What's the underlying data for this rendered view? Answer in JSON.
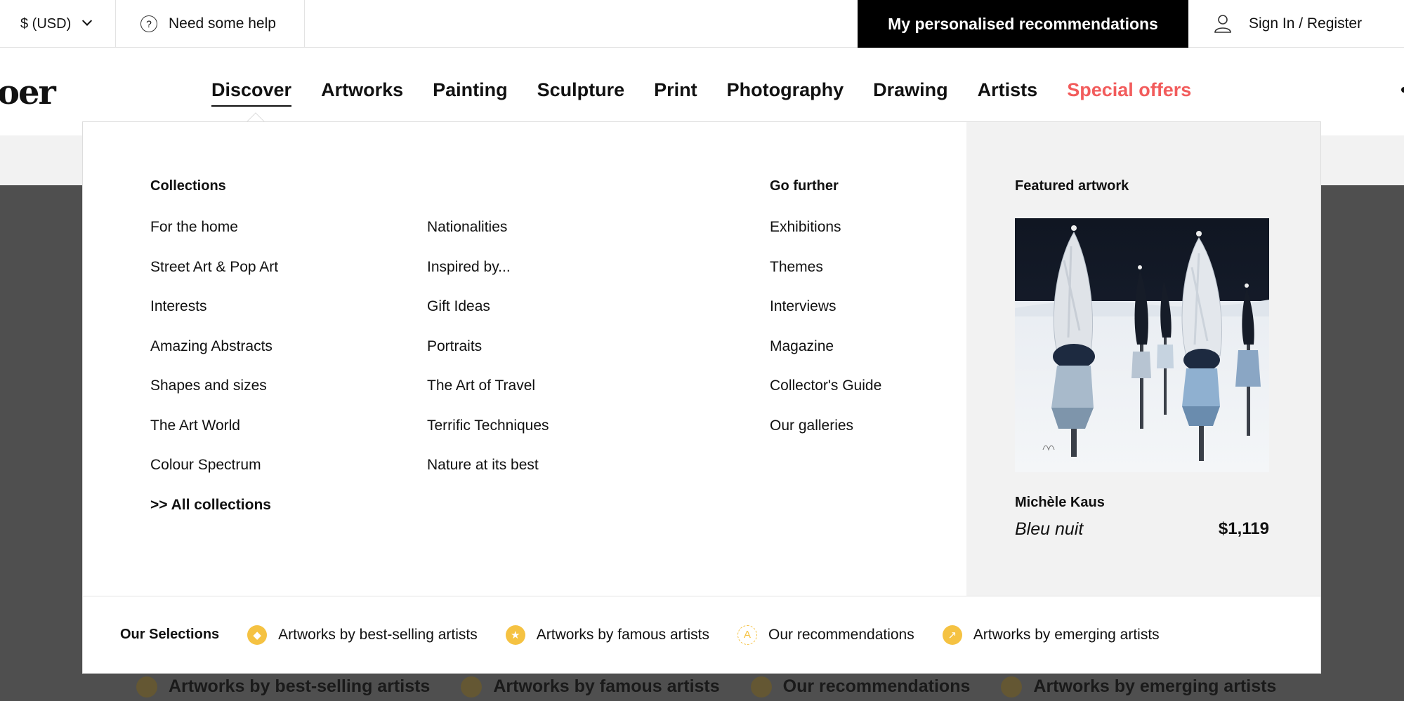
{
  "topbar": {
    "currency": "$ (USD)",
    "help": "Need some help",
    "recommendations": "My personalised recommendations",
    "signin": "Sign In / Register"
  },
  "logo": "oer",
  "nav": {
    "tabs": [
      "Discover",
      "Artworks",
      "Painting",
      "Sculpture",
      "Print",
      "Photography",
      "Drawing",
      "Artists",
      "Special offers"
    ],
    "active": "Discover"
  },
  "menu": {
    "collections_title": "Collections",
    "collections_col1": [
      "For the home",
      "Street Art & Pop Art",
      "Interests",
      "Amazing Abstracts",
      "Shapes and sizes",
      "The Art World",
      "Colour Spectrum",
      ">> All collections"
    ],
    "collections_col2": [
      "Nationalities",
      "Inspired by...",
      "Gift Ideas",
      "Portraits",
      "The Art of Travel",
      "Terrific Techniques",
      "Nature at its best"
    ],
    "gofurther_title": "Go further",
    "gofurther": [
      "Exhibitions",
      "Themes",
      "Interviews",
      "Magazine",
      "Collector's Guide",
      "Our galleries"
    ],
    "featured": {
      "title": "Featured artwork",
      "artist": "Michèle Kaus",
      "artwork": "Bleu nuit",
      "price": "$1,119"
    },
    "selections": {
      "title": "Our Selections",
      "items": [
        "Artworks by best-selling artists",
        "Artworks by famous artists",
        "Our recommendations",
        "Artworks by emerging artists"
      ]
    }
  },
  "colors": {
    "special": "#f25c5c",
    "gold": "#f5c242",
    "black": "#000000",
    "panel": "#f2f2f2"
  }
}
